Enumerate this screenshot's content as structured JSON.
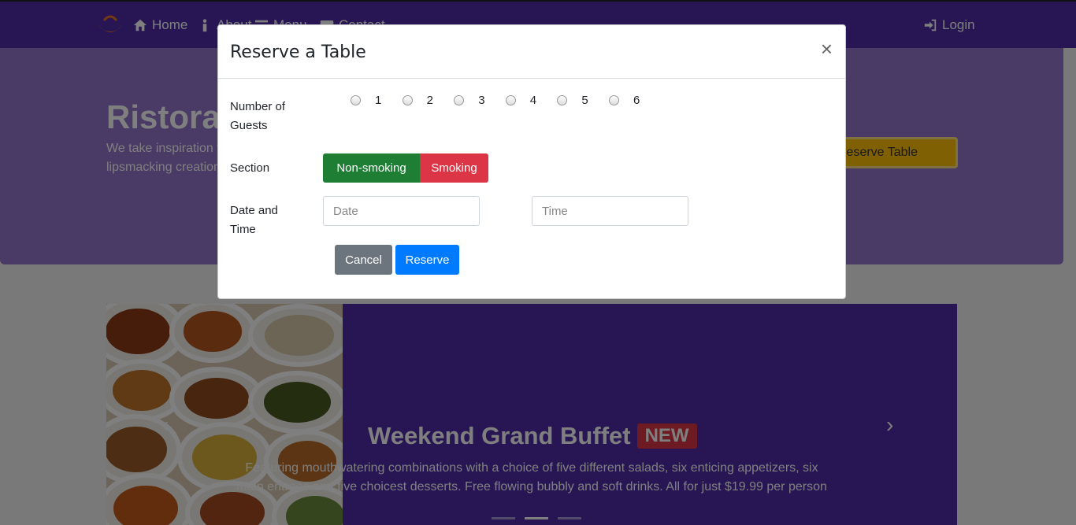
{
  "nav": {
    "home": "Home",
    "about": "About",
    "menu": "Menu",
    "contact": "Contact",
    "login": "Login"
  },
  "jumbotron": {
    "title": "Ristorante con Fusion",
    "text": "We take inspiration from the World's best cuisines, and create a unique fusion experience. Our lipsmacking creations will tickle your culinary senses!",
    "button": "Reserve Table"
  },
  "carousel": {
    "title": "Weekend Grand Buffet",
    "badge": "NEW",
    "text": "Featuring mouthwatering combinations with a choice of five different salads, six enticing appetizers, six main entrees and five choicest desserts. Free flowing bubbly and soft drinks. All for just $19.99 per person",
    "next_glyph": "›",
    "prev_glyph": "‹"
  },
  "modal": {
    "title": "Reserve a Table",
    "close_glyph": "×",
    "guests_label": "Number of Guests",
    "guest_options": [
      "1",
      "2",
      "3",
      "4",
      "5",
      "6"
    ],
    "section_label": "Section",
    "section_options": [
      "Non-smoking",
      "Smoking"
    ],
    "datetime_label": "Date and Time",
    "date_placeholder": "Date",
    "time_placeholder": "Time",
    "cancel": "Cancel",
    "reserve": "Reserve"
  },
  "colors": {
    "primary_dark": "#512da8",
    "primary_light": "#9575cd",
    "success": "#1e7e34",
    "danger": "#dc3545",
    "secondary": "#6c757d",
    "primary": "#007bff",
    "warning": "#ffc107"
  }
}
